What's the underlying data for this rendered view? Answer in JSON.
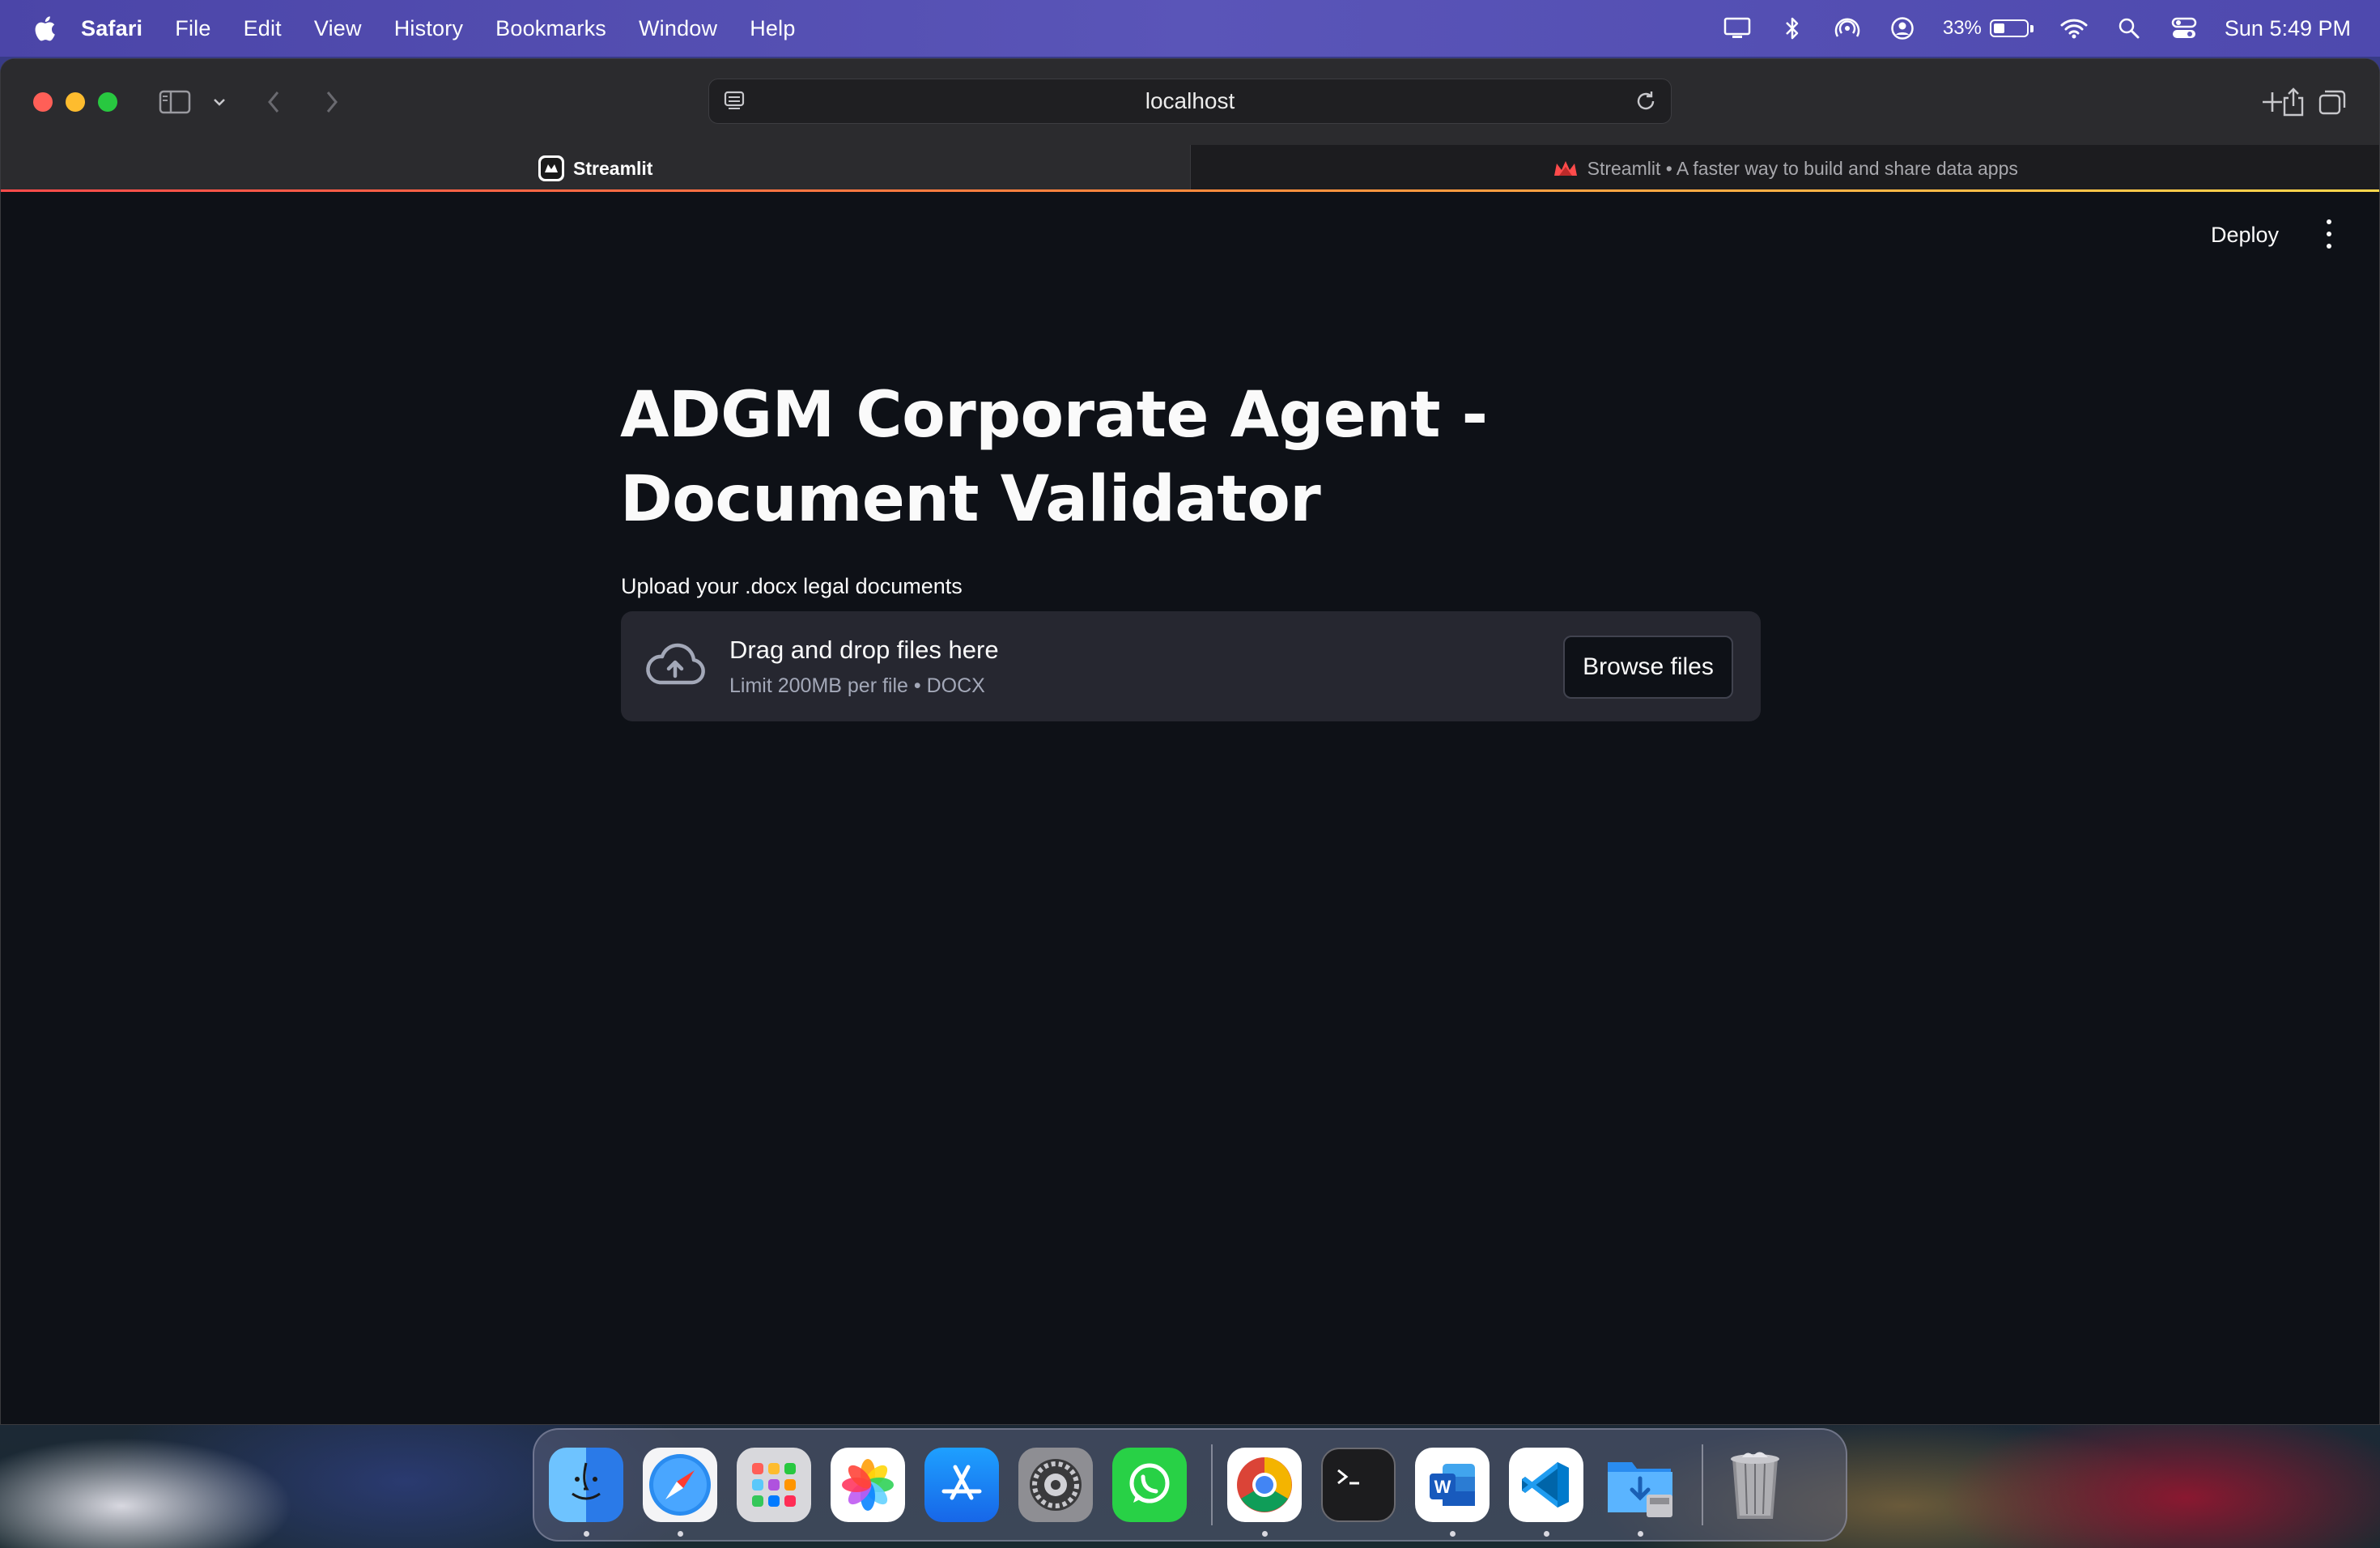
{
  "menubar": {
    "app_name": "Safari",
    "items": [
      "File",
      "Edit",
      "View",
      "History",
      "Bookmarks",
      "Window",
      "Help"
    ],
    "battery_percent": "33%",
    "battery_level": 0.33,
    "clock": "Sun 5:49 PM",
    "status_icons": [
      "display-icon",
      "bluetooth-icon",
      "airdrop-icon",
      "user-icon",
      "battery-icon",
      "wifi-icon",
      "spotlight-icon",
      "control-center-icon"
    ]
  },
  "browser": {
    "url": "localhost",
    "tabs": [
      {
        "label": "Streamlit",
        "active": true
      },
      {
        "label": "Streamlit • A faster way to build and share data apps",
        "active": false
      }
    ]
  },
  "app": {
    "deploy_label": "Deploy",
    "title": "ADGM Corporate Agent - Document Validator",
    "uploader": {
      "label": "Upload your .docx legal documents",
      "drop_text": "Drag and drop files here",
      "limit_text": "Limit 200MB per file • DOCX",
      "browse_label": "Browse files"
    }
  },
  "colors": {
    "streamlit_bg": "#0e1117",
    "dropzone_bg": "#262730",
    "streamlit_red": "#ff4b4b"
  },
  "dock": {
    "apps": [
      "finder",
      "safari",
      "launchpad",
      "photos",
      "app-store",
      "system-settings",
      "whatsapp",
      "chrome",
      "terminal",
      "word",
      "vscode",
      "downloads",
      "trash"
    ]
  }
}
